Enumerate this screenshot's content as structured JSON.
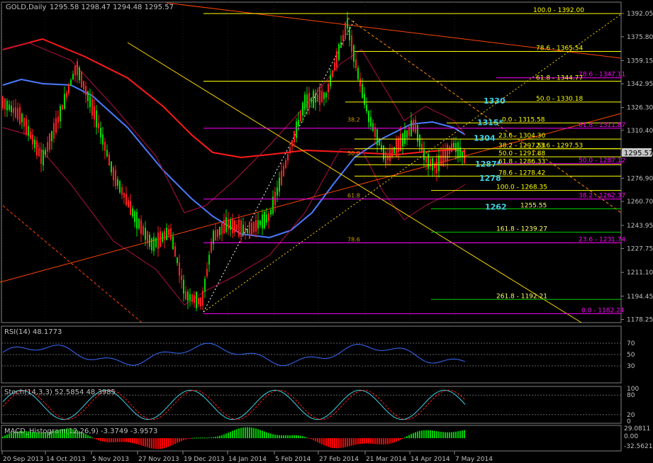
{
  "window": {
    "title": "GOLD,Daily",
    "ohlc": "1295.58 1298.47 1294.48 1295.57",
    "last_price": "1295.57"
  },
  "colors": {
    "background": "#000000",
    "grid": "#4a4a4a",
    "bull_candle": "#00dd00",
    "bear_candle": "#ff2020",
    "ma_fast": "#ff1a1a",
    "ma_slow": "#4a7bff",
    "bollinger": "#b0103e",
    "fib_magenta": "#ff00ff",
    "fib_yellow": "#ffff00",
    "fib_green": "#00cc00",
    "trendline": "#ff4500",
    "label_cyan": "#3fd3e8",
    "rsi": "#3a6bff",
    "stoch_main": "#3fd3e8",
    "stoch_signal": "#ff1a1a",
    "macd_pos": "#00cc00",
    "macd_neg": "#ff0000"
  },
  "chart_data": [
    {
      "type": "candlestick",
      "title": "GOLD,Daily",
      "ohlc_last": {
        "open": 1295.58,
        "high": 1298.47,
        "low": 1294.48,
        "close": 1295.57
      },
      "ylim": [
        1176.0,
        1400.0
      ],
      "y_ticks": [
        "1392.05",
        "1375.80",
        "1359.15",
        "1342.95",
        "1326.30",
        "1310.40",
        "1293.80",
        "1276.90",
        "1260.70",
        "1243.95",
        "1227.75",
        "1211.10",
        "1194.45",
        "1178.25"
      ],
      "x_ticks": [
        "20 Sep 2013",
        "14 Oct 2013",
        "5 Nov 2013",
        "27 Nov 2013",
        "19 Dec 2013",
        "14 Jan 2014",
        "5 Feb 2014",
        "27 Feb 2014",
        "21 Mar 2014",
        "14 Apr 2014",
        "7 May 2014"
      ],
      "fib_levels_right": [
        {
          "label": "100.0 - 1392.00",
          "value": 1392.0
        },
        {
          "label": "78.6 - 1365.54",
          "value": 1365.54
        },
        {
          "label": "78.6 - 1347.11",
          "value": 1347.11
        },
        {
          "label": "61.8 - 1344.77",
          "value": 1344.77
        },
        {
          "label": "50.0 - 1330.18",
          "value": 1330.18
        },
        {
          "label": "0.0 - 1315.58",
          "value": 1315.58
        },
        {
          "label": "61.8 - 1311.87",
          "value": 1311.87
        },
        {
          "label": "23.6 - 1304.30",
          "value": 1304.3
        },
        {
          "label": "23.6 - 1297.53",
          "value": 1297.53
        },
        {
          "label": "38.2 - 1297.53",
          "value": 1297.53
        },
        {
          "label": "50.0 - 1291.88",
          "value": 1291.88
        },
        {
          "label": "61.8 - 1286.33",
          "value": 1286.33
        },
        {
          "label": "50.0 - 1287.12",
          "value": 1287.12
        },
        {
          "label": "78.6 - 1278.42",
          "value": 1278.42
        },
        {
          "label": "100.0 - 1268.35",
          "value": 1268.35
        },
        {
          "label": "38.2 - 1262.37",
          "value": 1262.37
        },
        {
          "label": "1255.55",
          "value": 1255.55
        },
        {
          "label": "161.8 - 1239.27",
          "value": 1239.27
        },
        {
          "label": "23.6 - 1231.74",
          "value": 1231.74
        },
        {
          "label": "261.8 - 1192.21",
          "value": 1192.21
        },
        {
          "label": "0.0 - 1182.24",
          "value": 1182.24
        }
      ],
      "key_levels": [
        "1330",
        "1315*",
        "1304",
        "1287*",
        "1278",
        "1262"
      ],
      "inner_fib_labels": [
        "38.2",
        "50.0",
        "61.8",
        "78.6"
      ]
    },
    {
      "type": "line",
      "title": "RSI(14) 48.1773",
      "ylim": [
        0,
        100
      ],
      "levels": [
        30,
        50,
        70
      ],
      "y_ticks": [
        "70",
        "50",
        "30"
      ],
      "last": 48.1773
    },
    {
      "type": "line",
      "title": "Stoch(14,3,3) 52.5854 48.3985",
      "ylim": [
        0,
        100
      ],
      "levels": [
        20,
        80
      ],
      "y_ticks": [
        "100",
        "80",
        "20",
        "0"
      ],
      "main_last": 52.5854,
      "signal_last": 48.3985
    },
    {
      "type": "bar",
      "title": "MACD_Histogram(12,26,9) -3.3749 -3.9573",
      "y_ticks": [
        "29.0811",
        "0.00",
        "-32.5621"
      ],
      "values_last": [
        -3.3749,
        -3.9573
      ]
    }
  ]
}
